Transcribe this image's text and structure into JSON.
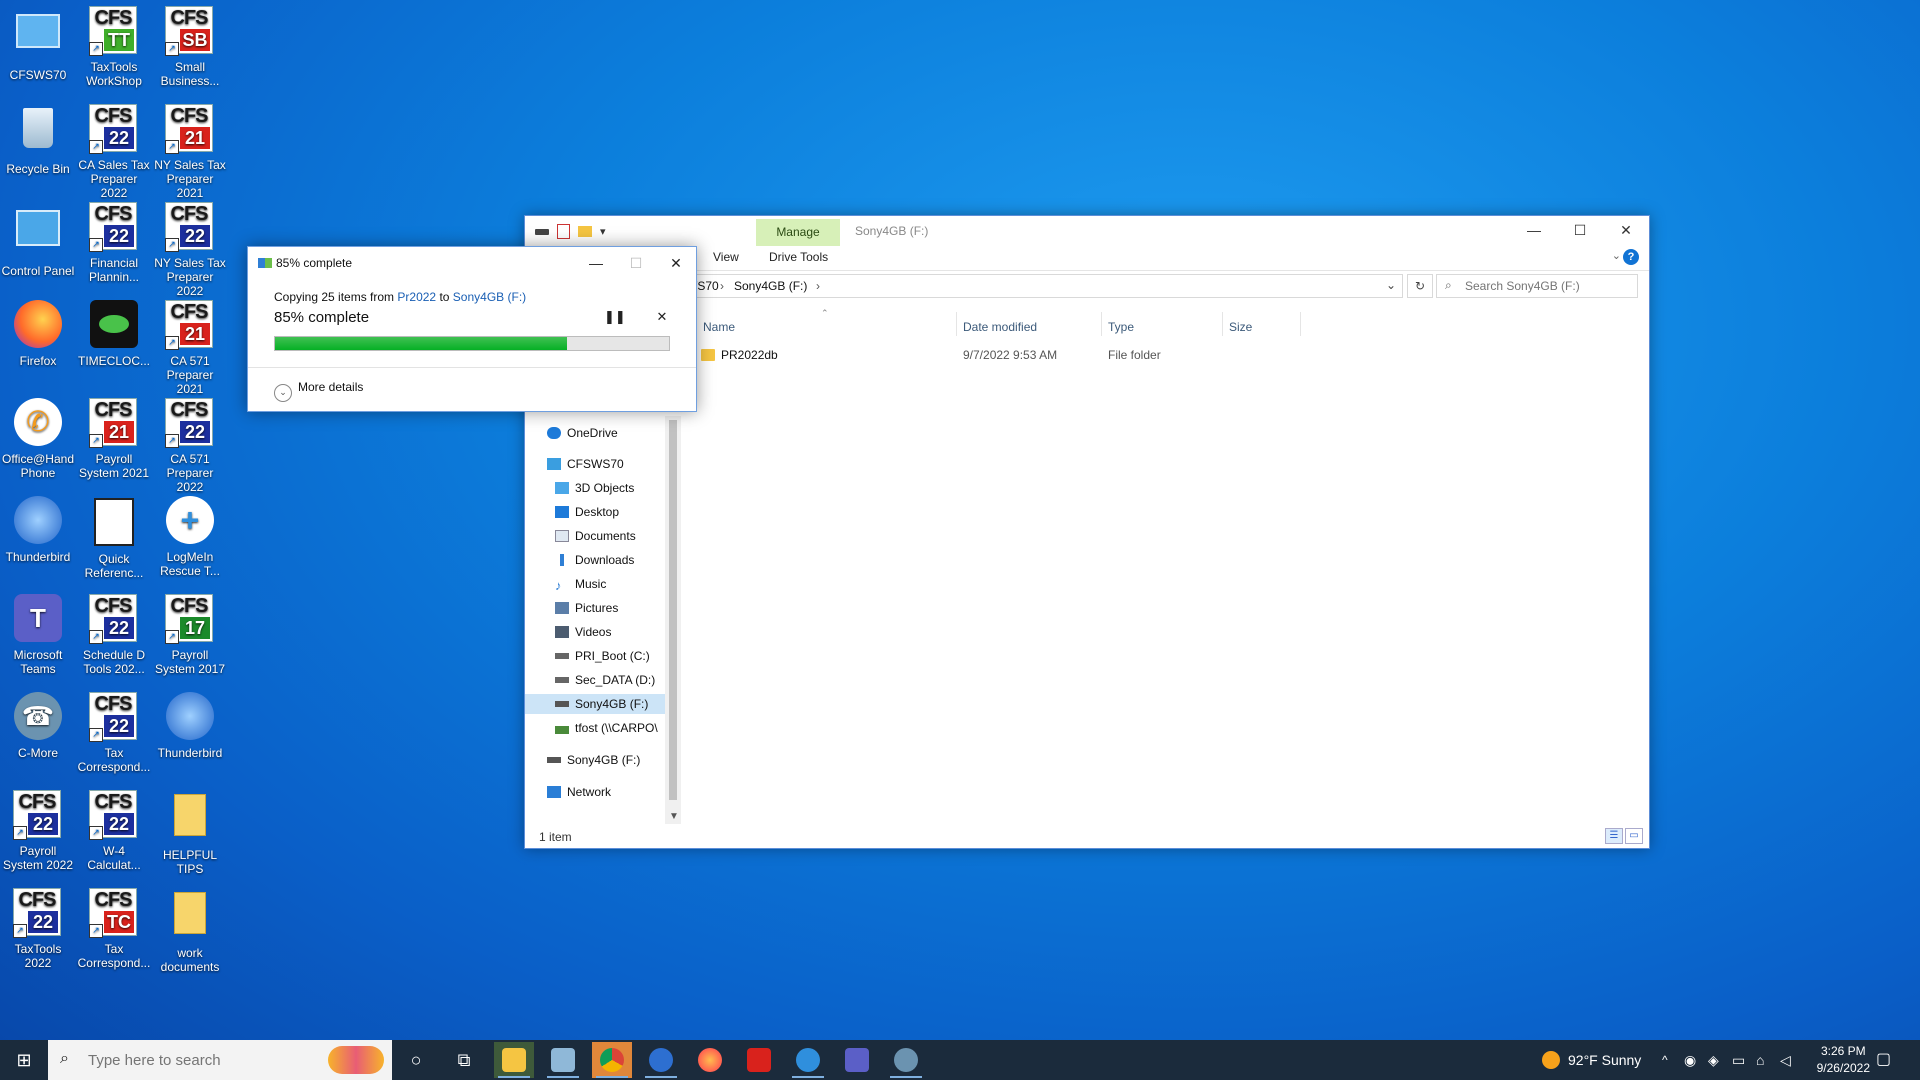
{
  "desktop": {
    "icons": [
      {
        "label": "CFSWS70"
      },
      {
        "label": "TaxTools WorkShop",
        "top": "CFS",
        "badge": "TT"
      },
      {
        "label": "Small Business...",
        "top": "CFS",
        "badge": "SB"
      },
      {
        "label": "Recycle Bin"
      },
      {
        "label": "CA Sales Tax Preparer 2022",
        "top": "CFS",
        "badge": "22"
      },
      {
        "label": "NY Sales Tax Preparer 2021",
        "top": "CFS",
        "badge": "21"
      },
      {
        "label": "Control Panel"
      },
      {
        "label": "Financial Plannin...",
        "top": "CFS",
        "badge": "22"
      },
      {
        "label": "NY Sales Tax Preparer 2022",
        "top": "CFS",
        "badge": "22"
      },
      {
        "label": "Firefox"
      },
      {
        "label": "TIMECLOC..."
      },
      {
        "label": "CA 571 Preparer 2021",
        "top": "CFS",
        "badge": "21"
      },
      {
        "label": "Office@Hand Phone"
      },
      {
        "label": "Payroll System 2021",
        "top": "CFS",
        "badge": "21"
      },
      {
        "label": "CA 571 Preparer 2022",
        "top": "CFS",
        "badge": "22"
      },
      {
        "label": "Thunderbird"
      },
      {
        "label": "Quick Referenc..."
      },
      {
        "label": "LogMeIn Rescue T..."
      },
      {
        "label": "Microsoft Teams"
      },
      {
        "label": "Schedule D Tools 202...",
        "top": "CFS",
        "badge": "22"
      },
      {
        "label": "Payroll System 2017",
        "top": "CFS",
        "badge": "17"
      },
      {
        "label": "C-More"
      },
      {
        "label": "Tax Correspond...",
        "top": "CFS",
        "badge": "22"
      },
      {
        "label": "Thunderbird"
      },
      {
        "label": "Payroll System 2022",
        "top": "CFS",
        "badge": "22"
      },
      {
        "label": "W-4 Calculat...",
        "top": "CFS",
        "badge": "22"
      },
      {
        "label": "HELPFUL TIPS"
      },
      {
        "label": "TaxTools 2022",
        "top": "CFS",
        "badge": "22"
      },
      {
        "label": "Tax Correspond...",
        "top": "CFS",
        "badge": "TC"
      },
      {
        "label": "work documents"
      }
    ]
  },
  "explorer": {
    "title": "Sony4GB (F:)",
    "manage_tab": "Manage",
    "ribbon_tabs": [
      "View",
      "Drive Tools"
    ],
    "help": "?",
    "address": {
      "crumb1": "WS70",
      "crumb2": "Sony4GB (F:)",
      "sep": "›"
    },
    "search_placeholder": "Search Sony4GB (F:)",
    "columns": {
      "name": "Name",
      "date": "Date modified",
      "type": "Type",
      "size": "Size"
    },
    "rows": [
      {
        "name": "PR2022db",
        "date": "9/7/2022 9:53 AM",
        "type": "File folder",
        "size": ""
      }
    ],
    "nav": {
      "onedrive": "OneDrive",
      "pc": "CFSWS70",
      "items": [
        "3D Objects",
        "Desktop",
        "Documents",
        "Downloads",
        "Music",
        "Pictures",
        "Videos",
        "PRI_Boot (C:)",
        "Sec_DATA (D:)",
        "Sony4GB (F:)",
        "tfost (\\\\CARPO\\"
      ],
      "drive": "Sony4GB (F:)",
      "network": "Network"
    },
    "status": "1 item"
  },
  "copy_dialog": {
    "title": "85% complete",
    "line_prefix": "Copying 25 items from",
    "source": "Pr2022",
    "line_mid": "to",
    "dest": "Sony4GB (F:)",
    "percent_label": "85% complete",
    "progress": 0.74,
    "more_details": "More details"
  },
  "taskbar": {
    "search_placeholder": "Type here to search",
    "weather": "92°F  Sunny",
    "time": "3:26 PM",
    "date": "9/26/2022"
  },
  "colors": {
    "accent": "#0a78d7",
    "progress_green": "#06b025",
    "taskbar": "#1b2b3c",
    "manage_tab": "#d7f0b8"
  }
}
